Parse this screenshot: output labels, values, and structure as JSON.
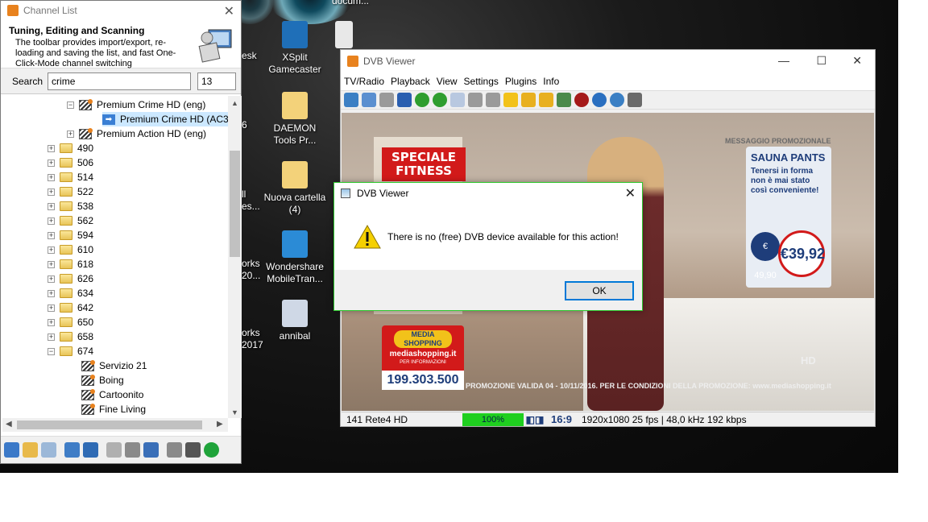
{
  "desktop": {
    "icons": [
      {
        "label": "XSplit Gamecaster",
        "color": "#1f6fb8"
      },
      {
        "label": "DAEMON Tools Pr...",
        "color": "#f3d27a"
      },
      {
        "label": "Nuova cartella (4)",
        "color": "#f3d27a"
      },
      {
        "label": "Wondershare MobileTran...",
        "color": "#2b8bd6"
      },
      {
        "label": "annibal",
        "color": "#cfd8e6"
      }
    ],
    "cut_labels": [
      "esk",
      "6",
      "ll",
      "es...",
      "orks",
      "20...",
      "orks",
      "2017",
      "docum..."
    ]
  },
  "channel_list": {
    "title": "Channel List",
    "info_heading": "Tuning, Editing and Scanning",
    "info_text": "The toolbar provides import/export, re-loading and saving the list, and fast One-Click-Mode channel switching",
    "search_label": "Search",
    "search_value": "crime",
    "count_value": "13",
    "tree": [
      {
        "label": "Premium Crime HD (eng)",
        "type": "channel",
        "expanded": true
      },
      {
        "label": "Premium Crime HD (AC3,",
        "type": "selected"
      },
      {
        "label": "Premium Action HD (eng)",
        "type": "channel"
      },
      {
        "label": "490",
        "type": "folder"
      },
      {
        "label": "506",
        "type": "folder"
      },
      {
        "label": "514",
        "type": "folder"
      },
      {
        "label": "522",
        "type": "folder"
      },
      {
        "label": "538",
        "type": "folder"
      },
      {
        "label": "562",
        "type": "folder"
      },
      {
        "label": "594",
        "type": "folder"
      },
      {
        "label": "610",
        "type": "folder"
      },
      {
        "label": "618",
        "type": "folder"
      },
      {
        "label": "626",
        "type": "folder"
      },
      {
        "label": "634",
        "type": "folder"
      },
      {
        "label": "642",
        "type": "folder"
      },
      {
        "label": "650",
        "type": "folder"
      },
      {
        "label": "658",
        "type": "folder"
      },
      {
        "label": "674",
        "type": "folder-open"
      },
      {
        "label": "Servizio 21",
        "type": "channel"
      },
      {
        "label": "Boing",
        "type": "channel"
      },
      {
        "label": "Cartoonito",
        "type": "channel"
      },
      {
        "label": "Fine Living",
        "type": "channel"
      }
    ]
  },
  "dvb_viewer": {
    "title": "DVB Viewer",
    "menu": [
      "TV/Radio",
      "Playback",
      "View",
      "Settings",
      "Plugins",
      "Info"
    ],
    "video": {
      "speciale": "SPECIALE FITNESS",
      "promo_header": "MESSAGGIO PROMOZIONALE",
      "product": "SAUNA PANTS",
      "product_desc": "Tenersi in forma non è mai stato così conveniente!",
      "old_price": "€ 49,90",
      "new_price": "€39,92",
      "brand": "MEDIA SHOPPING",
      "brand_site": "mediashopping.it",
      "info_label": "PER INFORMAZIONI",
      "phone": "199.303.500",
      "promo_strip": "PROMOZIONE VALIDA 04 - 10/11/2016. PER LE CONDIZIONI DELLA PROMOZIONE: www.mediashopping.it",
      "channel_logo": "HD"
    },
    "status": {
      "channel": "141 Rete4 HD",
      "signal": "100%",
      "aspect": "16:9",
      "format": "1920x1080 25 fps | 48,0 kHz 192 kbps"
    }
  },
  "dialog": {
    "title": "DVB Viewer",
    "message": "There is no (free) DVB device available for this action!",
    "ok_label": "OK"
  }
}
